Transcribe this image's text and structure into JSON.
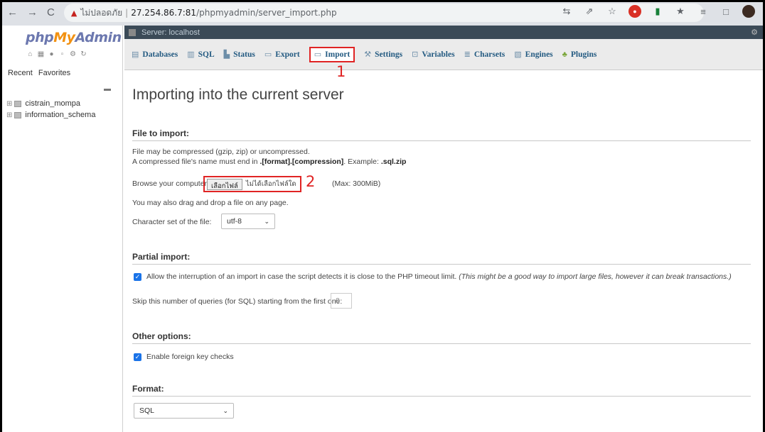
{
  "browser": {
    "back": "←",
    "forward": "→",
    "reload": "C",
    "security_label": "ไม่ปลอดภัย",
    "separator": "|",
    "host": "27.254.86.7:81",
    "path": "/phpmyadmin/server_import.php"
  },
  "sidebar": {
    "logo_php": "php",
    "logo_my": "My",
    "logo_admin": "Admin",
    "recent_label": "Recent",
    "favorites_label": "Favorites",
    "databases": [
      {
        "name": "cistrain_mompa"
      },
      {
        "name": "information_schema"
      }
    ]
  },
  "server_strip": {
    "label": "Server: localhost"
  },
  "tabs": [
    {
      "label": "Databases",
      "icon": "database-icon"
    },
    {
      "label": "SQL",
      "icon": "sql-icon"
    },
    {
      "label": "Status",
      "icon": "status-icon"
    },
    {
      "label": "Export",
      "icon": "export-icon"
    },
    {
      "label": "Import",
      "icon": "import-icon"
    },
    {
      "label": "Settings",
      "icon": "wrench-icon"
    },
    {
      "label": "Variables",
      "icon": "variables-icon"
    },
    {
      "label": "Charsets",
      "icon": "charsets-icon"
    },
    {
      "label": "Engines",
      "icon": "engines-icon"
    },
    {
      "label": "Plugins",
      "icon": "plugins-icon"
    }
  ],
  "annotations": {
    "marker1": "1",
    "marker2": "2"
  },
  "main": {
    "title": "Importing into the current server",
    "file_section": {
      "heading": "File to import:",
      "line1": "File may be compressed (gzip, zip) or uncompressed.",
      "line2_prefix": "A compressed file's name must end in ",
      "line2_format": ".[format].[compression]",
      "line2_mid": ". Example: ",
      "line2_example": ".sql.zip",
      "browse_label": "Browse your computer:",
      "choose_file_button": "เลือกไฟล์",
      "no_file_text": "ไม่ได้เลือกไฟล์ใด",
      "max_size": "(Max: 300MiB)",
      "drag_hint": "You may also drag and drop a file on any page.",
      "charset_label": "Character set of the file:",
      "charset_value": "utf-8"
    },
    "partial_section": {
      "heading": "Partial import:",
      "allow_interrupt_text": "Allow the interruption of an import in case the script detects it is close to the PHP timeout limit.",
      "allow_interrupt_note": "(This might be a good way to import large files, however it can break transactions.)",
      "skip_label": "Skip this number of queries (for SQL) starting from the first one:",
      "skip_value": "0"
    },
    "other_section": {
      "heading": "Other options:",
      "foreign_key_label": "Enable foreign key checks"
    },
    "format_section": {
      "heading": "Format:",
      "format_value": "SQL"
    }
  },
  "colors": {
    "annotation_red": "#e02424",
    "tab_text": "#235a81",
    "checkbox": "#1a73e8"
  }
}
